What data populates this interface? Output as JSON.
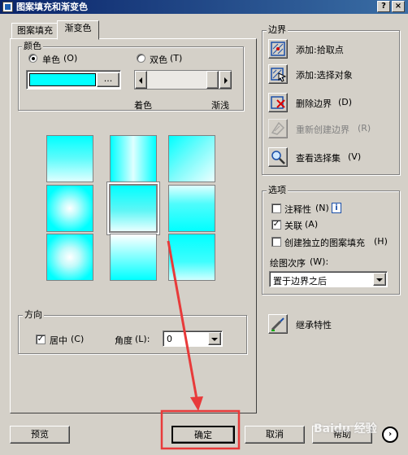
{
  "window": {
    "title": "图案填充和渐变色",
    "help_glyph": "?",
    "close_glyph": "×"
  },
  "tabs": [
    {
      "label": "图案填充"
    },
    {
      "label": "渐变色"
    }
  ],
  "color": {
    "legend": "颜色",
    "single": "单色",
    "single_key": "(O)",
    "double": "双色",
    "double_key": "(T)",
    "browse": "...",
    "swatch": "#00ffff",
    "shade_label": "着色",
    "tint_label": "渐浅"
  },
  "gradient_tiles": [
    {
      "style": "linear-vertical"
    },
    {
      "style": "cylinder-horizontal"
    },
    {
      "style": "linear-diagonal"
    },
    {
      "style": "radial-center"
    },
    {
      "style": "spherical-selected"
    },
    {
      "style": "linear-vertical-inverse"
    },
    {
      "style": "radial-bottom"
    },
    {
      "style": "fade-top"
    },
    {
      "style": "fade-bottom"
    }
  ],
  "orientation": {
    "legend": "方向",
    "centered": "居中",
    "centered_key": "(C)",
    "angle_label": "角度",
    "angle_key": "(L):",
    "angle_value": "0"
  },
  "boundaries": {
    "legend": "边界",
    "items": [
      {
        "label": "添加:拾取点",
        "key": "",
        "icon": "pick-points-icon",
        "enabled": true
      },
      {
        "label": "添加:选择对象",
        "key": "",
        "icon": "select-objects-icon",
        "enabled": true
      },
      {
        "label": "删除边界",
        "key": "(D)",
        "icon": "remove-boundary-icon",
        "enabled": true
      },
      {
        "label": "重新创建边界",
        "key": "(R)",
        "icon": "recreate-boundary-icon",
        "enabled": false
      },
      {
        "label": "查看选择集",
        "key": "(V)",
        "icon": "magnifier-icon",
        "enabled": true
      }
    ]
  },
  "options": {
    "legend": "选项",
    "annotative": "注释性",
    "annotative_key": "(N)",
    "annotative_checked": false,
    "associative": "关联",
    "associative_key": "(A)",
    "associative_checked": true,
    "separate": "创建独立的图案填充",
    "separate_key": "(H)",
    "separate_checked": false,
    "draw_order_label": "绘图次序",
    "draw_order_key": "(W):",
    "draw_order_value": "置于边界之后"
  },
  "inherit_label": "继承特性",
  "footer": {
    "preview": "预览",
    "ok": "确定",
    "cancel": "取消",
    "help": "帮助"
  },
  "watermark": "Baidu 经验"
}
